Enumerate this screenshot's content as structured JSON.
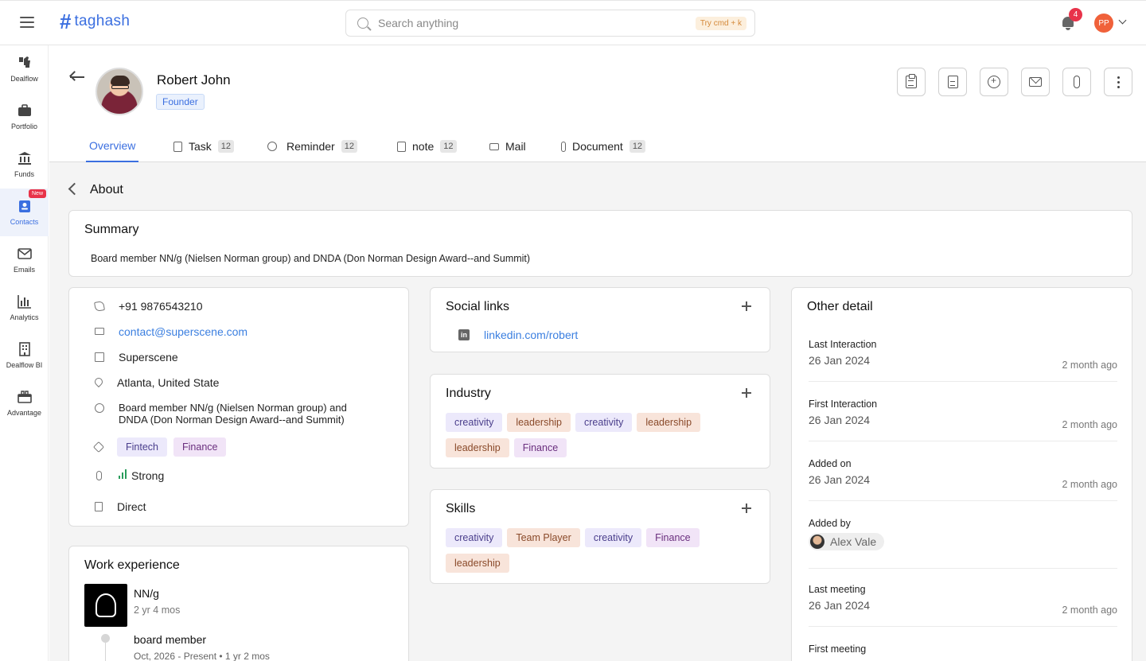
{
  "app": {
    "name": "taghash",
    "search_placeholder": "Search anything",
    "search_hint": "Try cmd + k",
    "notification_count": "4",
    "user_initials": "PP"
  },
  "sidebar": {
    "items": [
      {
        "label": "Dealflow",
        "icon": "thumbs-icon"
      },
      {
        "label": "Portfolio",
        "icon": "briefcase-icon"
      },
      {
        "label": "Funds",
        "icon": "bank-icon"
      },
      {
        "label": "Contacts",
        "icon": "contact-card-icon",
        "badge": "New",
        "active": true
      },
      {
        "label": "Emails",
        "icon": "mail-icon"
      },
      {
        "label": "Analytics",
        "icon": "bar-chart-icon"
      },
      {
        "label": "Dealflow BI",
        "icon": "building-icon"
      },
      {
        "label": "Advantage",
        "icon": "gift-icon"
      }
    ]
  },
  "profile": {
    "name": "Robert John",
    "role": "Founder"
  },
  "tabs": [
    {
      "label": "Overview",
      "active": true
    },
    {
      "label": "Task",
      "count": "12"
    },
    {
      "label": "Reminder",
      "count": "12"
    },
    {
      "label": "note",
      "count": "12"
    },
    {
      "label": "Mail"
    },
    {
      "label": "Document",
      "count": "12"
    }
  ],
  "about": {
    "title": "About",
    "summary_title": "Summary",
    "summary_text": "Board member NN/g (Nielsen Norman group) and DNDA (Don Norman Design Award--and Summit)"
  },
  "contact": {
    "phone": "+91 9876543210",
    "email": "contact@superscene.com",
    "company": "Superscene",
    "location": "Atlanta, United State",
    "bio_line1": "Board member NN/g (Nielsen Norman group) and",
    "bio_line2": "DNDA (Don Norman Design Award--and Summit)",
    "tags": [
      "Fintech",
      "Finance"
    ],
    "strength": "Strong",
    "source": "Direct"
  },
  "social": {
    "title": "Social links",
    "linkedin": "linkedin.com/robert"
  },
  "industry": {
    "title": "Industry",
    "chips": [
      "creativity",
      "leadership",
      "creativity",
      "leadership",
      "leadership",
      "Finance"
    ]
  },
  "skills": {
    "title": "Skills",
    "chips": [
      "creativity",
      "Team Player",
      "creativity",
      "Finance",
      "leadership"
    ]
  },
  "other": {
    "title": "Other detail",
    "rows": [
      {
        "label": "Last Interaction",
        "value": "26 Jan 2024",
        "ago": "2 month ago"
      },
      {
        "label": "First Interaction",
        "value": "26 Jan 2024",
        "ago": "2 month ago"
      },
      {
        "label": "Added on",
        "value": "26 Jan 2024",
        "ago": "2 month ago"
      },
      {
        "label": "Added by",
        "person": "Alex Vale"
      },
      {
        "label": "Last meeting",
        "value": "26 Jan 2024",
        "ago": "2 month ago"
      },
      {
        "label": "First meeting"
      }
    ]
  },
  "work": {
    "title": "Work experience",
    "company": "NN/g",
    "duration": "2 yr 4 mos",
    "role": "board member",
    "dates": "Oct, 2026 - Present • 1 yr 2 mos"
  }
}
